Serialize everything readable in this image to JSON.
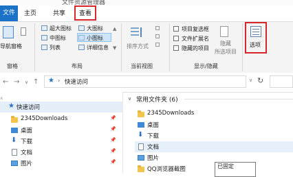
{
  "window": {
    "title": "文件资源管理器"
  },
  "tabs": [
    {
      "label": "文件"
    },
    {
      "label": "主页"
    },
    {
      "label": "共享"
    },
    {
      "label": "查看"
    }
  ],
  "ribbon": {
    "pane_group": {
      "nav_pane_label": "导航窗格",
      "group_label": "窗格"
    },
    "layout_group": {
      "items": [
        "超大图标",
        "大图标",
        "中图标",
        "小图标",
        "列表",
        "详细信息"
      ],
      "group_label": "布局"
    },
    "current_view_group": {
      "sort_label": "排序方式",
      "group_label": "当前视图"
    },
    "show_hide_group": {
      "checkboxes": [
        "项目复选框",
        "文件扩展名",
        "隐藏的项目"
      ],
      "hide_label": "隐藏",
      "hide_sub_label": "所选项目",
      "group_label": "显示/隐藏"
    },
    "options_label": "选项"
  },
  "address": {
    "path": "快速访问"
  },
  "nav": {
    "items": [
      {
        "label": "快速访问",
        "pinned": false,
        "selected": true
      },
      {
        "label": "2345Downloads",
        "pinned": true
      },
      {
        "label": "桌面",
        "pinned": true
      },
      {
        "label": "下载",
        "pinned": true
      },
      {
        "label": "文档",
        "pinned": true
      },
      {
        "label": "图片",
        "pinned": true
      }
    ]
  },
  "content": {
    "section_title": "常用文件夹 (6)",
    "items": [
      {
        "label": "2345Downloads"
      },
      {
        "label": "桌面"
      },
      {
        "label": "下载"
      },
      {
        "label": "文档"
      },
      {
        "label": "图片"
      },
      {
        "label": "QQ浏览器截图"
      }
    ]
  },
  "tooltip": {
    "line1": "已固定"
  },
  "colors": {
    "accent": "#1a73c7",
    "highlight": "#d6262a",
    "folder": "#f3c54f"
  }
}
